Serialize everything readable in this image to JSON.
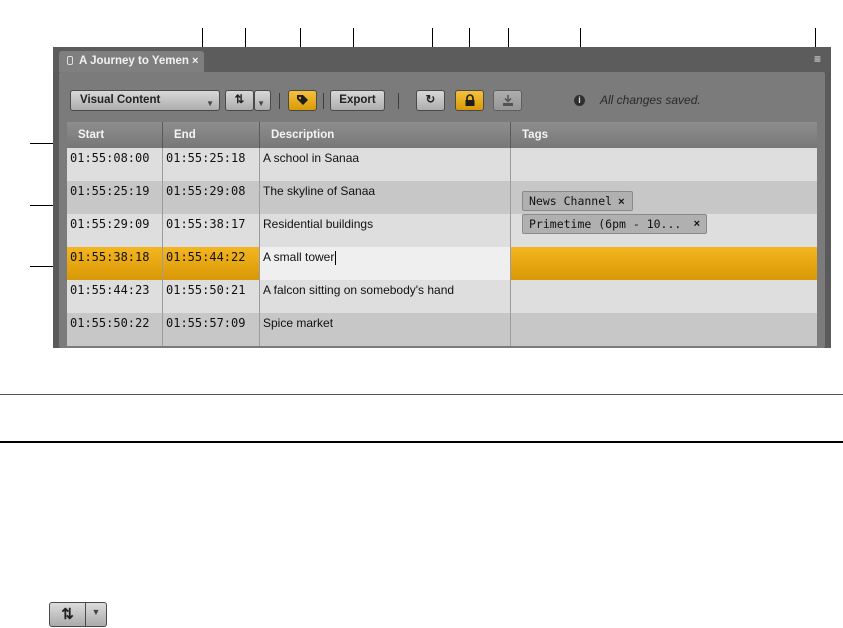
{
  "panel": {
    "tab_title": "A Journey to Yemen",
    "tab_close": "×",
    "menu_icon": "hamburger-menu-icon"
  },
  "toolbar": {
    "view_select": "Visual Content",
    "export_label": "Export",
    "status": "All changes saved.",
    "icons": {
      "sort": "sort-arrows-icon",
      "tag": "tag-icon",
      "refresh": "refresh-icon",
      "lock": "lock-icon",
      "import": "import-icon",
      "info": "info-icon"
    },
    "accent": "#e8a810"
  },
  "table": {
    "headers": [
      "Start",
      "End",
      "Description",
      "Tags"
    ],
    "rows": [
      {
        "start": "01:55:08:00",
        "end": "01:55:25:18",
        "description": "A school in Sanaa",
        "tags": []
      },
      {
        "start": "01:55:25:19",
        "end": "01:55:29:08",
        "description": "The skyline of Sanaa",
        "tags": [
          "News Channel"
        ]
      },
      {
        "start": "01:55:29:09",
        "end": "01:55:38:17",
        "description": "Residential buildings",
        "tags": [
          "Primetime (6pm - 10..."
        ]
      },
      {
        "start": "01:55:38:18",
        "end": "01:55:44:22",
        "description": "A small tower",
        "tags": [],
        "selected": true
      },
      {
        "start": "01:55:44:23",
        "end": "01:55:50:21",
        "description": "A falcon sitting on somebody's hand",
        "tags": []
      },
      {
        "start": "01:55:50:22",
        "end": "01:55:57:09",
        "description": "Spice market",
        "tags": []
      }
    ],
    "tag_remove": "×"
  }
}
